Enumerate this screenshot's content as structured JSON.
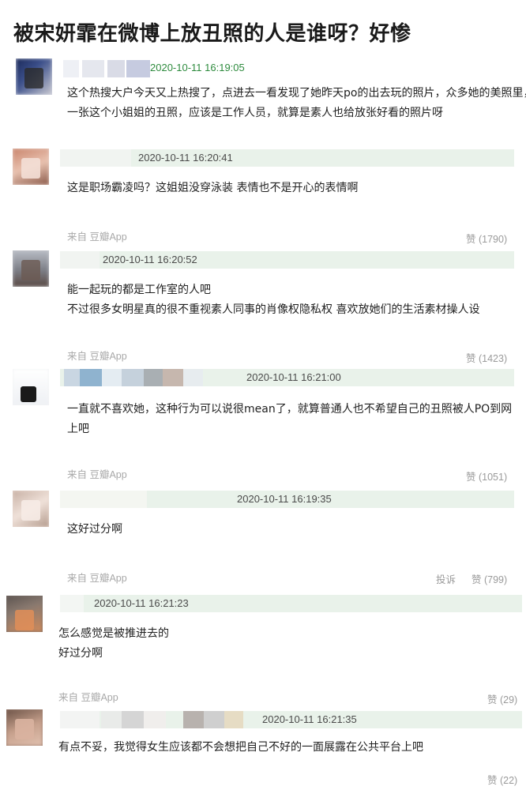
{
  "title": "被宋妍霏在微博上放丑照的人是谁呀？好惨",
  "colors": {
    "header_bar": "#e9f2ea",
    "timestamp_green": "#2e8b3e",
    "meta_gray": "#a8a8a8"
  },
  "comments": [
    {
      "timestamp": "2020-10-11 16:19:05",
      "lines": [
        "这个热搜大户今天又上热搜了，点进去一看发现了她昨天po的出去玩的照片，众多她的美照里，有",
        "一张这个小姐姐的丑照，应该是工作人员，就算是素人也给放张好看的照片呀"
      ]
    },
    {
      "timestamp": "2020-10-11 16:20:41",
      "lines": [
        "这是职场霸凌吗？这姐姐没穿泳装 表情也不是开心的表情啊"
      ],
      "source": "来自 豆瓣App",
      "likes": "赞 (1790)"
    },
    {
      "timestamp": "2020-10-11 16:20:52",
      "lines": [
        "能一起玩的都是工作室的人吧",
        "不过很多女明星真的很不重视素人同事的肖像权隐私权 喜欢放她们的生活素材操人设"
      ],
      "source": "来自 豆瓣App",
      "likes": "赞 (1423)"
    },
    {
      "timestamp": "2020-10-11 16:21:00",
      "lines": [
        "一直就不喜欢她，这种行为可以说很mean了，就算普通人也不希望自己的丑照被人PO到网",
        "上吧"
      ],
      "source": "来自 豆瓣App",
      "likes": "赞 (1051)"
    },
    {
      "timestamp": "2020-10-11 16:19:35",
      "lines": [
        "这好过分啊"
      ],
      "source": "来自 豆瓣App",
      "report": "投诉",
      "likes": "赞 (799)"
    },
    {
      "timestamp": "2020-10-11 16:21:23",
      "lines": [
        "怎么感觉是被推进去的",
        "好过分啊"
      ],
      "source": "来自 豆瓣App",
      "likes": "赞 (29)"
    },
    {
      "timestamp": "2020-10-11 16:21:35",
      "lines": [
        "有点不妥，我觉得女生应该都不会想把自己不好的一面展露在公共平台上吧"
      ],
      "likes": "赞 (22)"
    }
  ]
}
